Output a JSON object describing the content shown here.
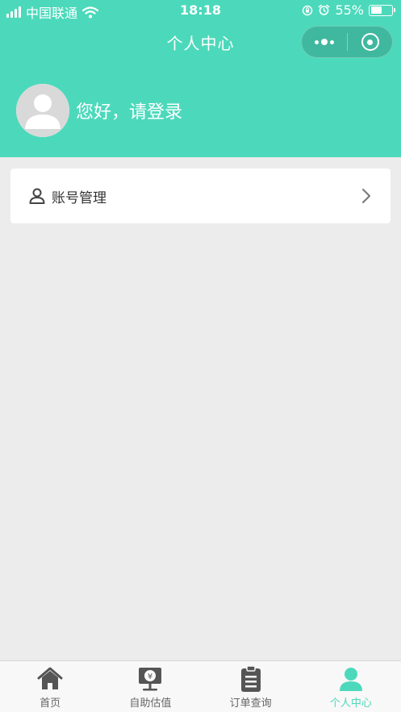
{
  "status_bar": {
    "carrier": "中国联通",
    "time": "18:18",
    "battery_percent": "55%",
    "battery_level": 0.55
  },
  "nav": {
    "title": "个人中心"
  },
  "profile": {
    "greeting": "您好，请登录"
  },
  "menu": {
    "account_label": "账号管理"
  },
  "tabbar": {
    "items": [
      {
        "label": "首页",
        "icon": "home-icon",
        "active": false
      },
      {
        "label": "自助估值",
        "icon": "valuation-icon",
        "active": false
      },
      {
        "label": "订单查询",
        "icon": "clipboard-icon",
        "active": false
      },
      {
        "label": "个人中心",
        "icon": "person-icon",
        "active": true
      }
    ]
  },
  "colors": {
    "accent": "#4cd9bb",
    "background": "#ececec",
    "tab_inactive": "#666666",
    "tab_icon_inactive": "#555555"
  }
}
